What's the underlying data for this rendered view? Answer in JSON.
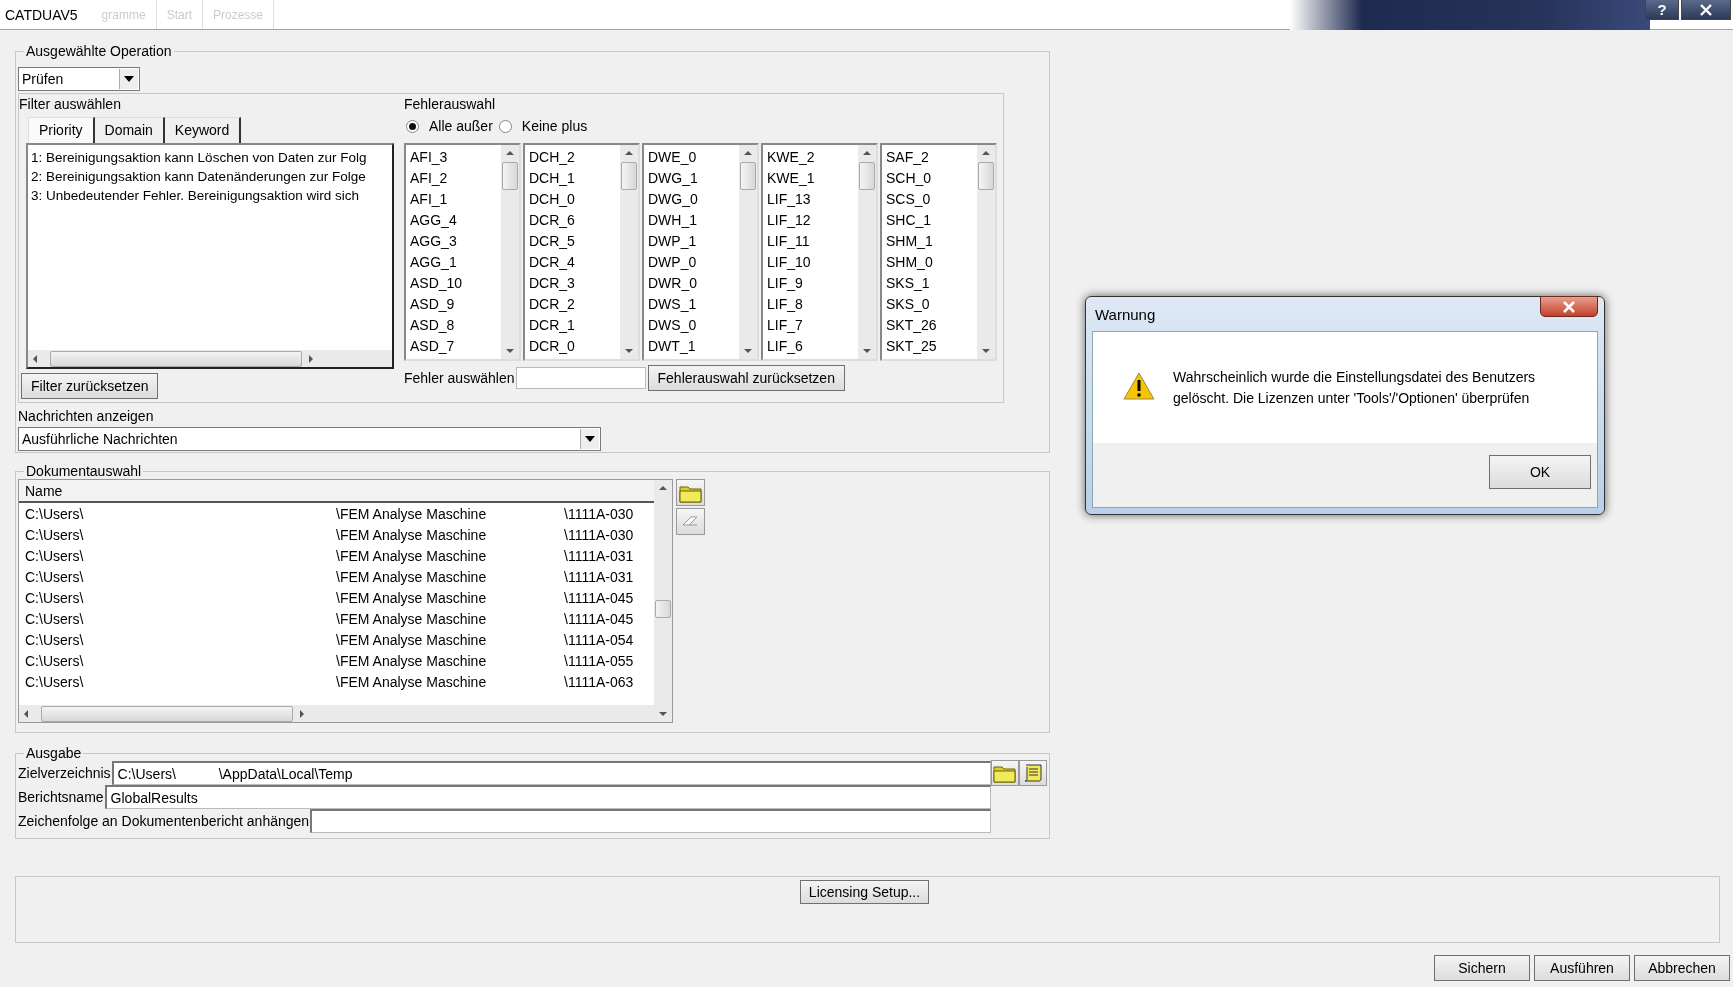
{
  "window": {
    "title": "CATDUAV5",
    "background_tabs": [
      "gramme",
      "Start",
      "Prozesse"
    ],
    "help_button": "?"
  },
  "operation": {
    "legend": "Ausgewählte Operation",
    "dropdown": {
      "value": "Prüfen"
    },
    "filter": {
      "label": "Filter auswählen",
      "tabs": [
        {
          "label": "Priority",
          "selected": true
        },
        {
          "label": "Domain",
          "selected": false
        },
        {
          "label": "Keyword",
          "selected": false
        }
      ],
      "items": [
        "1: Bereinigungsaktion kann Löschen von Daten zur Folg",
        "2: Bereinigungsaktion kann Datenänderungen zur Folge",
        "3: Unbedeutender Fehler. Bereinigungsaktion wird sich"
      ],
      "reset_button": "Filter zurücksetzen"
    },
    "errors": {
      "label": "Fehlerauswahl",
      "radios": [
        {
          "label": "Alle außer",
          "selected": true
        },
        {
          "label": "Keine plus",
          "selected": false
        }
      ],
      "lists": [
        [
          "AFI_3",
          "AFI_2",
          "AFI_1",
          "AGG_4",
          "AGG_3",
          "AGG_1",
          "ASD_10",
          "ASD_9",
          "ASD_8",
          "ASD_7"
        ],
        [
          "DCH_2",
          "DCH_1",
          "DCH_0",
          "DCR_6",
          "DCR_5",
          "DCR_4",
          "DCR_3",
          "DCR_2",
          "DCR_1",
          "DCR_0"
        ],
        [
          "DWE_0",
          "DWG_1",
          "DWG_0",
          "DWH_1",
          "DWP_1",
          "DWP_0",
          "DWR_0",
          "DWS_1",
          "DWS_0",
          "DWT_1"
        ],
        [
          "KWE_2",
          "KWE_1",
          "LIF_13",
          "LIF_12",
          "LIF_11",
          "LIF_10",
          "LIF_9",
          "LIF_8",
          "LIF_7",
          "LIF_6"
        ],
        [
          "SAF_2",
          "SCH_0",
          "SCS_0",
          "SHC_1",
          "SHM_1",
          "SHM_0",
          "SKS_1",
          "SKS_0",
          "SKT_26",
          "SKT_25"
        ]
      ],
      "select_label": "Fehler auswählen",
      "reset_button": "Fehlerauswahl zurücksetzen"
    },
    "messages": {
      "label": "Nachrichten anzeigen",
      "value": "Ausführliche Nachrichten"
    }
  },
  "documents": {
    "legend": "Dokumentauswahl",
    "columns": [
      "Name"
    ],
    "rows": [
      [
        "C:\\Users\\",
        "\\FEM Analyse Maschine",
        "\\1111A-030"
      ],
      [
        "C:\\Users\\",
        "\\FEM Analyse Maschine",
        "\\1111A-030"
      ],
      [
        "C:\\Users\\",
        "\\FEM Analyse Maschine",
        "\\1111A-031"
      ],
      [
        "C:\\Users\\",
        "\\FEM Analyse Maschine",
        "\\1111A-031"
      ],
      [
        "C:\\Users\\",
        "\\FEM Analyse Maschine",
        "\\1111A-045"
      ],
      [
        "C:\\Users\\",
        "\\FEM Analyse Maschine",
        "\\1111A-045"
      ],
      [
        "C:\\Users\\",
        "\\FEM Analyse Maschine",
        "\\1111A-054"
      ],
      [
        "C:\\Users\\",
        "\\FEM Analyse Maschine",
        "\\1111A-055"
      ],
      [
        "C:\\Users\\",
        "\\FEM Analyse Maschine",
        "\\1111A-063"
      ]
    ]
  },
  "output": {
    "legend": "Ausgabe",
    "fields": [
      {
        "label": "Zielverzeichnis",
        "value": "C:\\Users\\           \\AppData\\Local\\Temp",
        "kind": "path"
      },
      {
        "label": "Berichtsname",
        "value": "GlobalResults",
        "kind": "text"
      },
      {
        "label": "Zeichenfolge an Dokumentenbericht anhängen",
        "kind": "text"
      }
    ]
  },
  "licensing_button": "Licensing Setup...",
  "buttons": [
    "Sichern",
    "Ausführen",
    "Abbrechen"
  ],
  "dialog": {
    "title": "Warnung",
    "message": "Wahrscheinlich wurde die Einstellungsdatei des Benutzers gelöscht. Die Lizenzen unter 'Tools'/'Optionen' überprüfen",
    "button": "OK"
  }
}
